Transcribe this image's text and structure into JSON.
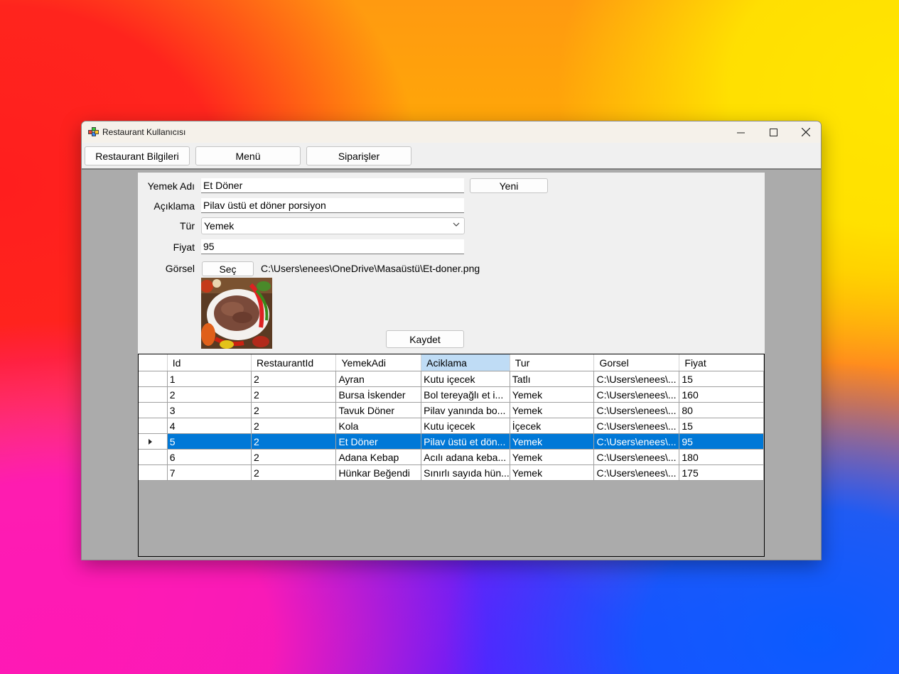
{
  "window": {
    "title": "Restaurant Kullanıcısı"
  },
  "topbar": {
    "buttons": [
      {
        "label": "Restaurant Bilgileri"
      },
      {
        "label": "Menü"
      },
      {
        "label": "Siparişler"
      }
    ]
  },
  "form": {
    "yemek_adi_label": "Yemek Adı",
    "yemek_adi_value": "Et Döner",
    "aciklama_label": "Açıklama",
    "aciklama_value": "Pilav üstü et döner porsiyon",
    "tur_label": "Tür",
    "tur_value": "Yemek",
    "fiyat_label": "Fiyat",
    "fiyat_value": "95",
    "gorsel_label": "Görsel",
    "sec_button": "Seç",
    "gorsel_path": "C:\\Users\\enees\\OneDrive\\Masaüstü\\Et-doner.png",
    "yeni_button": "Yeni",
    "kaydet_button": "Kaydet"
  },
  "grid": {
    "columns": [
      "Id",
      "RestaurantId",
      "YemekAdi",
      "Aciklama",
      "Tur",
      "Gorsel",
      "Fiyat"
    ],
    "selected_column": "Aciklama",
    "rows": [
      [
        "1",
        "2",
        "Ayran",
        "Kutu içecek",
        "Tatlı",
        "C:\\Users\\enees\\...",
        "15"
      ],
      [
        "2",
        "2",
        "Bursa İskender",
        "Bol tereyağlı et i...",
        "Yemek",
        "C:\\Users\\enees\\...",
        "160"
      ],
      [
        "3",
        "2",
        "Tavuk Döner",
        "Pilav yanında bo...",
        "Yemek",
        "C:\\Users\\enees\\...",
        "80"
      ],
      [
        "4",
        "2",
        "Kola",
        "Kutu içecek",
        "İçecek",
        "C:\\Users\\enees\\...",
        "15"
      ],
      [
        "5",
        "2",
        "Et Döner",
        "Pilav üstü et dön...",
        "Yemek",
        "C:\\Users\\enees\\...",
        "95"
      ],
      [
        "6",
        "2",
        "Adana Kebap",
        "Acılı adana keba...",
        "Yemek",
        "C:\\Users\\enees\\...",
        "180"
      ],
      [
        "7",
        "2",
        "Hünkar Beğendi",
        "Sınırlı sayıda hün...",
        "Yemek",
        "C:\\Users\\enees\\...",
        "175"
      ]
    ],
    "selected_row_index": 4
  },
  "colors": {
    "selection": "#0078d7",
    "header_selected": "#bfdcf5",
    "client_bg": "#ababab"
  }
}
